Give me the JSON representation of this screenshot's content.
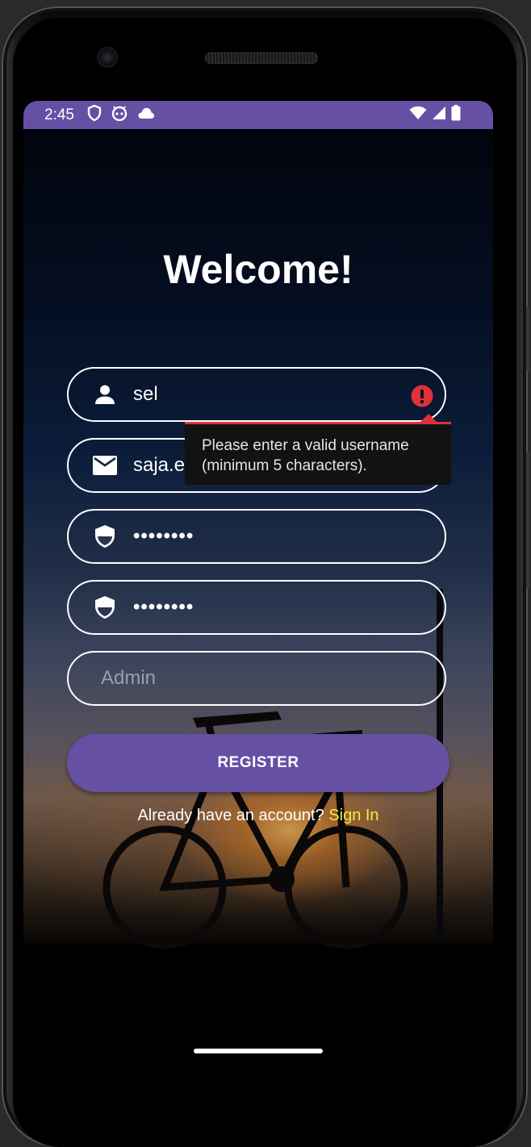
{
  "status_bar": {
    "time": "2:45",
    "left_icons": [
      "shield-icon",
      "robot-icon",
      "cloud-icon"
    ],
    "right_icons": [
      "wifi-icon",
      "cell-signal-icon",
      "battery-icon"
    ],
    "color": "#6650a4"
  },
  "form": {
    "title": "Welcome!",
    "username": {
      "value": "sel",
      "icon": "person-icon"
    },
    "email": {
      "value": "saja.elkhaldi@gmail.com",
      "icon": "mail-icon"
    },
    "password": {
      "value": "••••••••",
      "icon": "shield-icon"
    },
    "confirm_password": {
      "value": "••••••••",
      "icon": "shield-icon"
    },
    "role": {
      "placeholder": "Admin"
    },
    "error": {
      "icon": "error-icon",
      "line1": "Please enter a valid username",
      "line2": "(minimum 5 characters).",
      "color": "#e0303a"
    },
    "register_label": "REGISTER",
    "signin_prompt": "Already have an account? ",
    "signin_link": "Sign In",
    "accent_color": "#6650a4",
    "link_color": "#f3ea3f"
  }
}
